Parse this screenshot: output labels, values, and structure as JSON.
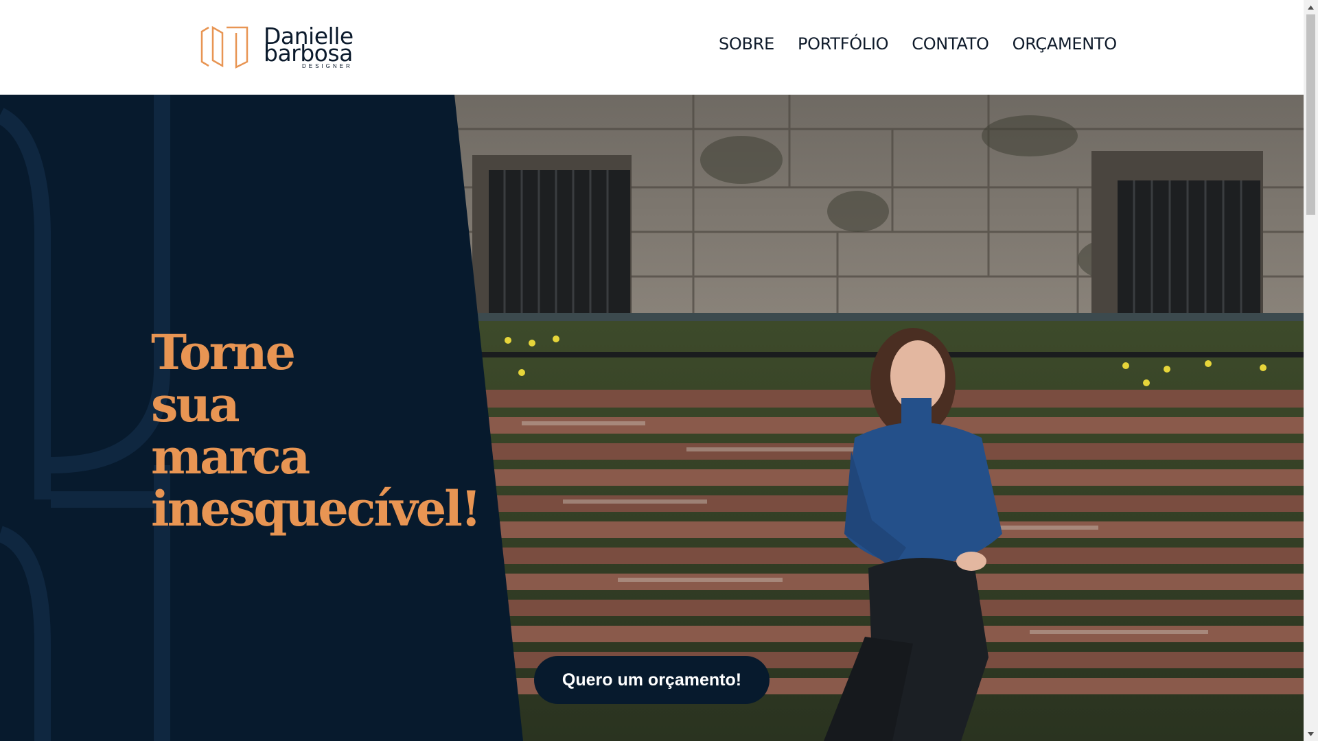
{
  "brand": {
    "name_line1": "Danielle",
    "name_line2": "barbosa",
    "tagline": "DESIGNER",
    "accent_color": "#e89553",
    "navy_color": "#071a2d"
  },
  "nav": {
    "items": [
      {
        "label": "SOBRE"
      },
      {
        "label": "PORTFÓLIO"
      },
      {
        "label": "CONTATO"
      },
      {
        "label": "ORÇAMENTO"
      }
    ]
  },
  "hero": {
    "headline_lines": [
      "Torne",
      "sua",
      "marca",
      "inesquecível!"
    ],
    "cta_label": "Quero um orçamento!",
    "photo_description_icon": "person-on-bench-photo"
  },
  "scrollbar": {
    "up_icon": "triangle-up-icon",
    "down_icon": "triangle-down-icon"
  }
}
